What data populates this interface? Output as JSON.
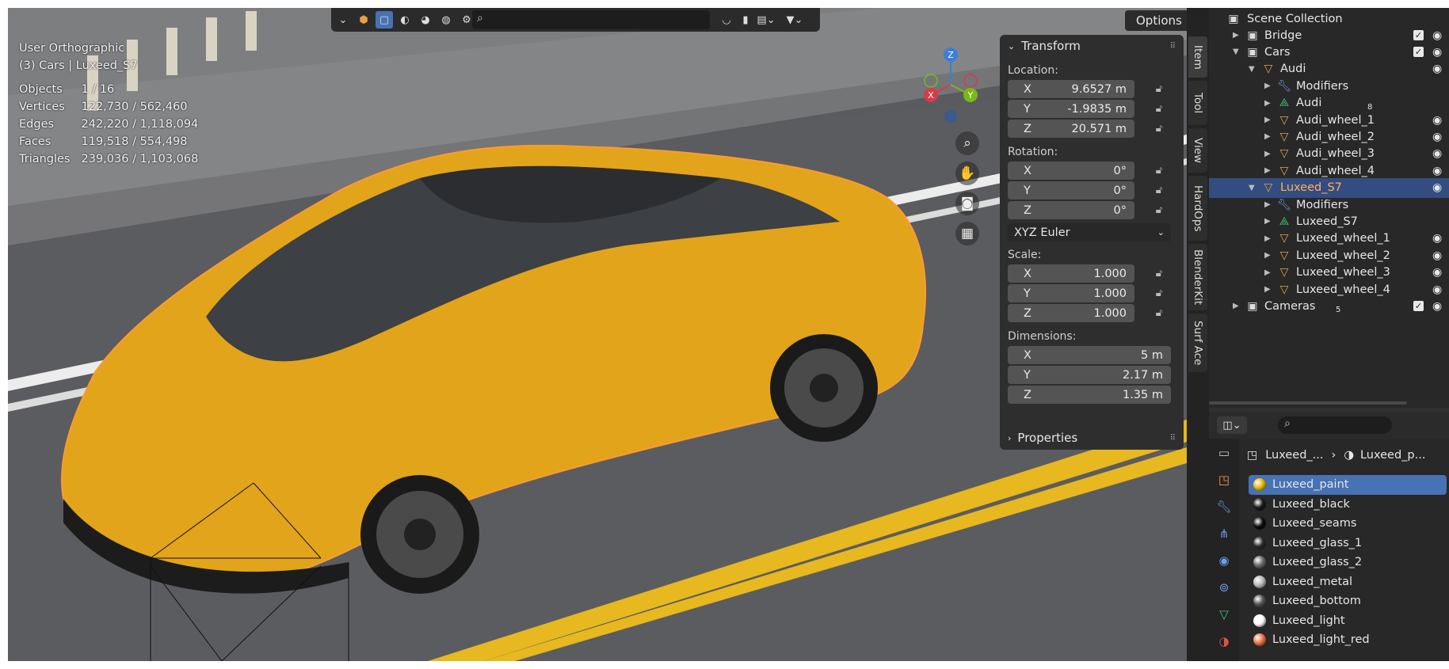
{
  "viewport": {
    "view_name": "User Orthographic",
    "context": "(3) Cars | Luxeed_S7",
    "stats": [
      {
        "label": "Objects",
        "value": "1 / 16"
      },
      {
        "label": "Vertices",
        "value": "122,730 / 562,460"
      },
      {
        "label": "Edges",
        "value": "242,220 / 1,118,094"
      },
      {
        "label": "Faces",
        "value": "119,518 / 554,498"
      },
      {
        "label": "Triangles",
        "value": "239,036 / 1,103,068"
      }
    ],
    "options_label": "Options",
    "gizmo": {
      "x": "X",
      "y": "Y",
      "z": "Z"
    }
  },
  "transform": {
    "title": "Transform",
    "location_label": "Location:",
    "location": [
      {
        "axis": "X",
        "value": "9.6527 m"
      },
      {
        "axis": "Y",
        "value": "-1.9835 m"
      },
      {
        "axis": "Z",
        "value": "20.571 m"
      }
    ],
    "rotation_label": "Rotation:",
    "rotation": [
      {
        "axis": "X",
        "value": "0°"
      },
      {
        "axis": "Y",
        "value": "0°"
      },
      {
        "axis": "Z",
        "value": "0°"
      }
    ],
    "rotation_mode": "XYZ Euler",
    "scale_label": "Scale:",
    "scale": [
      {
        "axis": "X",
        "value": "1.000"
      },
      {
        "axis": "Y",
        "value": "1.000"
      },
      {
        "axis": "Z",
        "value": "1.000"
      }
    ],
    "dimensions_label": "Dimensions:",
    "dimensions": [
      {
        "axis": "X",
        "value": "5 m"
      },
      {
        "axis": "Y",
        "value": "2.17 m"
      },
      {
        "axis": "Z",
        "value": "1.35 m"
      }
    ],
    "properties_title": "Properties"
  },
  "side_tabs": [
    "Item",
    "Tool",
    "View",
    "HardOps",
    "BlenderKit",
    "Surf Ace"
  ],
  "outliner": {
    "root": "Scene Collection",
    "rows": [
      {
        "label": "Bridge",
        "depth": 1,
        "kind": "collection",
        "badge": "",
        "checkbox": true,
        "eye": true
      },
      {
        "label": "Cars",
        "depth": 1,
        "kind": "collection",
        "badge": "",
        "checkbox": true,
        "eye": true
      },
      {
        "label": "Audi",
        "depth": 2,
        "kind": "object",
        "badge": "",
        "checkbox": false,
        "eye": true
      },
      {
        "label": "Modifiers",
        "depth": 3,
        "kind": "modifier",
        "badge": "",
        "checkbox": false,
        "eye": false
      },
      {
        "label": "Audi",
        "depth": 3,
        "kind": "mesh",
        "badge": "8",
        "checkbox": false,
        "eye": false
      },
      {
        "label": "Audi_wheel_1",
        "depth": 3,
        "kind": "object",
        "badge": "",
        "checkbox": false,
        "eye": true
      },
      {
        "label": "Audi_wheel_2",
        "depth": 3,
        "kind": "object",
        "badge": "",
        "checkbox": false,
        "eye": true
      },
      {
        "label": "Audi_wheel_3",
        "depth": 3,
        "kind": "object",
        "badge": "",
        "checkbox": false,
        "eye": true
      },
      {
        "label": "Audi_wheel_4",
        "depth": 3,
        "kind": "object",
        "badge": "",
        "checkbox": false,
        "eye": true
      },
      {
        "label": "Luxeed_S7",
        "depth": 2,
        "kind": "object",
        "badge": "",
        "checkbox": false,
        "eye": true,
        "selected": true
      },
      {
        "label": "Modifiers",
        "depth": 3,
        "kind": "modifier",
        "badge": "",
        "checkbox": false,
        "eye": false
      },
      {
        "label": "Luxeed_S7",
        "depth": 3,
        "kind": "mesh",
        "badge": "",
        "checkbox": false,
        "eye": false
      },
      {
        "label": "Luxeed_wheel_1",
        "depth": 3,
        "kind": "object",
        "badge": "",
        "checkbox": false,
        "eye": true
      },
      {
        "label": "Luxeed_wheel_2",
        "depth": 3,
        "kind": "object",
        "badge": "",
        "checkbox": false,
        "eye": true
      },
      {
        "label": "Luxeed_wheel_3",
        "depth": 3,
        "kind": "object",
        "badge": "",
        "checkbox": false,
        "eye": true
      },
      {
        "label": "Luxeed_wheel_4",
        "depth": 3,
        "kind": "object",
        "badge": "",
        "checkbox": false,
        "eye": true
      },
      {
        "label": "Cameras",
        "depth": 1,
        "kind": "collection",
        "badge": "5",
        "checkbox": true,
        "eye": true
      }
    ]
  },
  "properties": {
    "breadcrumb_object": "Luxeed_...",
    "breadcrumb_material": "Luxeed_p...",
    "materials": [
      {
        "name": "Luxeed_paint",
        "color": "#e8b800",
        "selected": true
      },
      {
        "name": "Luxeed_black",
        "color": "#1a1a1a"
      },
      {
        "name": "Luxeed_seams",
        "color": "#0d0d0d"
      },
      {
        "name": "Luxeed_glass_1",
        "color": "#2a2a2a"
      },
      {
        "name": "Luxeed_glass_2",
        "color": "#6a6a6a"
      },
      {
        "name": "Luxeed_metal",
        "color": "#b8b8b8"
      },
      {
        "name": "Luxeed_bottom",
        "color": "#555555"
      },
      {
        "name": "Luxeed_light",
        "color": "#ffffff"
      },
      {
        "name": "Luxeed_light_red",
        "color": "#f07040"
      }
    ]
  },
  "colors": {
    "accent_blue": "#4772b3",
    "selection": "#334d80",
    "object_orange": "#e8a040",
    "mesh_green": "#40c080"
  }
}
